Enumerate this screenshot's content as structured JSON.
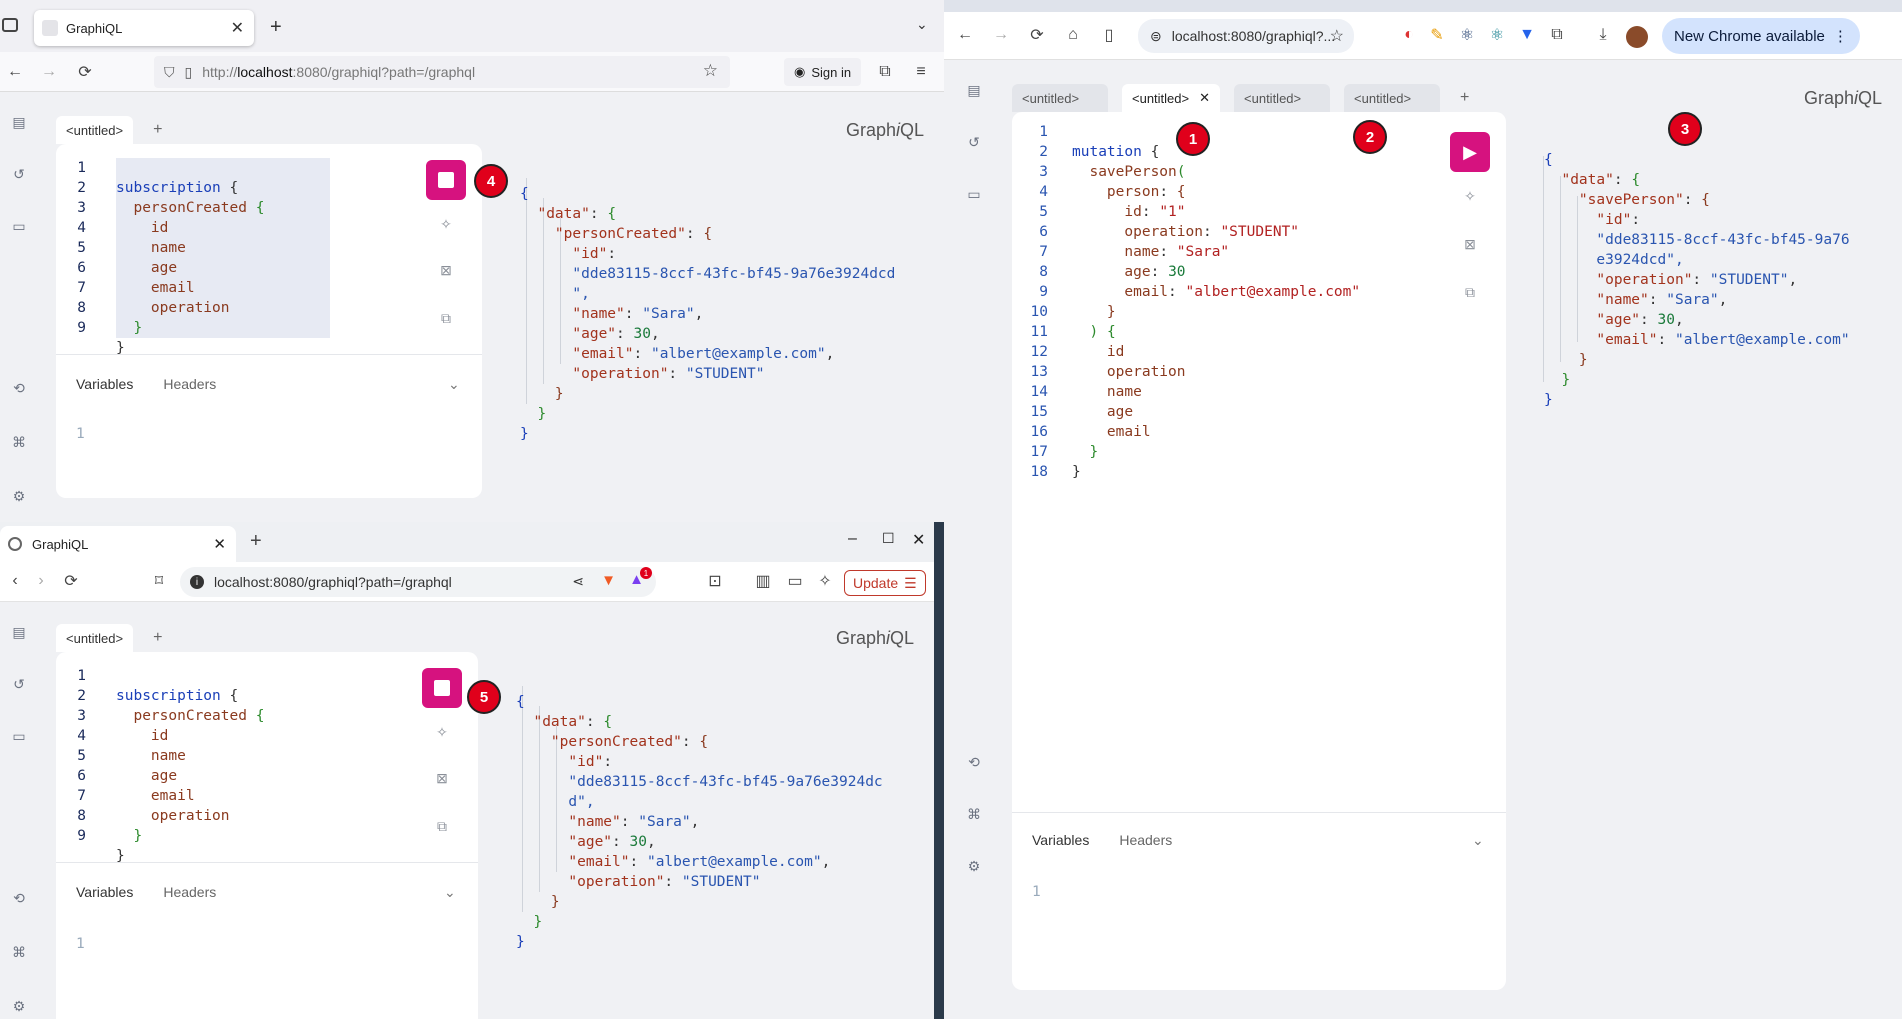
{
  "firefox": {
    "tab_title": "GraphiQL",
    "url_prefix": "http://",
    "url_host": "localhost",
    "url_rest": ":8080/graphiql?path=/graphql",
    "sign_in": "Sign in",
    "graphiql": {
      "tab": "<untitled>",
      "title_a": "Graph",
      "title_b": "i",
      "title_c": "QL",
      "line_numbers": "1\n2\n3\n4\n5\n6\n7\n8\n9",
      "variables_label": "Variables",
      "headers_label": "Headers",
      "var_line": "1",
      "marker": "4"
    }
  },
  "brave": {
    "tab_title": "GraphiQL",
    "url": "localhost:8080/graphiql?path=/graphql",
    "update_label": "Update",
    "badge": "1",
    "graphiql": {
      "tab": "<untitled>",
      "title_a": "Graph",
      "title_b": "i",
      "title_c": "QL",
      "line_numbers": "1\n2\n3\n4\n5\n6\n7\n8\n9",
      "variables_label": "Variables",
      "headers_label": "Headers",
      "var_line": "1",
      "marker": "5"
    }
  },
  "chrome": {
    "url": "localhost:8080/graphiql?...",
    "new_chrome": "New Chrome available",
    "graphiql": {
      "tabs": [
        "<untitled>",
        "<untitled>",
        "<untitled>",
        "<untitled>"
      ],
      "title_a": "Graph",
      "title_b": "i",
      "title_c": "QL",
      "line_numbers": "1\n2\n3\n4\n5\n6\n7\n8\n9\n10\n11\n12\n13\n14\n15\n16\n17\n18",
      "variables_label": "Variables",
      "headers_label": "Headers",
      "var_line": "1",
      "markers": [
        "1",
        "2",
        "3"
      ]
    }
  },
  "subscription_query": {
    "l1a": "subscription",
    "l1b": " {",
    "l2a": "personCreated",
    "l2b": " {",
    "f1": "id",
    "f2": "name",
    "f3": "age",
    "f4": "email",
    "f5": "operation",
    "close": "}"
  },
  "mutation_query": {
    "kw": "mutation",
    "op": "savePerson",
    "arg": "person",
    "id_key": "id",
    "id_val": "\"1\"",
    "op_key": "operation",
    "op_val": "\"STUDENT\"",
    "name_key": "name",
    "name_val": "\"Sara\"",
    "age_key": "age",
    "age_val": "30",
    "email_key": "email",
    "email_val": "\"albert@example.com\"",
    "sel1": "id",
    "sel2": "operation",
    "sel3": "name",
    "sel4": "age",
    "sel5": "email"
  },
  "response": {
    "data_key": "\"data\"",
    "created_key": "\"personCreated\"",
    "saved_key": "\"savePerson\"",
    "id_key": "\"id\"",
    "id_val": "\"dde83115-8ccf-43fc-bf45-9a76e3924dcd\"",
    "id_val_a": "\"dde83115-8ccf-43fc-bf45-9a76e3924dcd",
    "id_val_b": "\",",
    "id_val_c": "\"dde83115-8ccf-43fc-bf45-9a76e3924dc",
    "id_val_d": "d\",",
    "id_val_e": "\"dde83115-8ccf-43fc-bf45-9a76",
    "id_val_f": "e3924dcd\",",
    "name_key": "\"name\"",
    "name_val": "\"Sara\"",
    "age_key": "\"age\"",
    "age_val": "30",
    "email_key": "\"email\"",
    "email_val": "\"albert@example.com\"",
    "op_key": "\"operation\"",
    "op_val": "\"STUDENT\""
  }
}
